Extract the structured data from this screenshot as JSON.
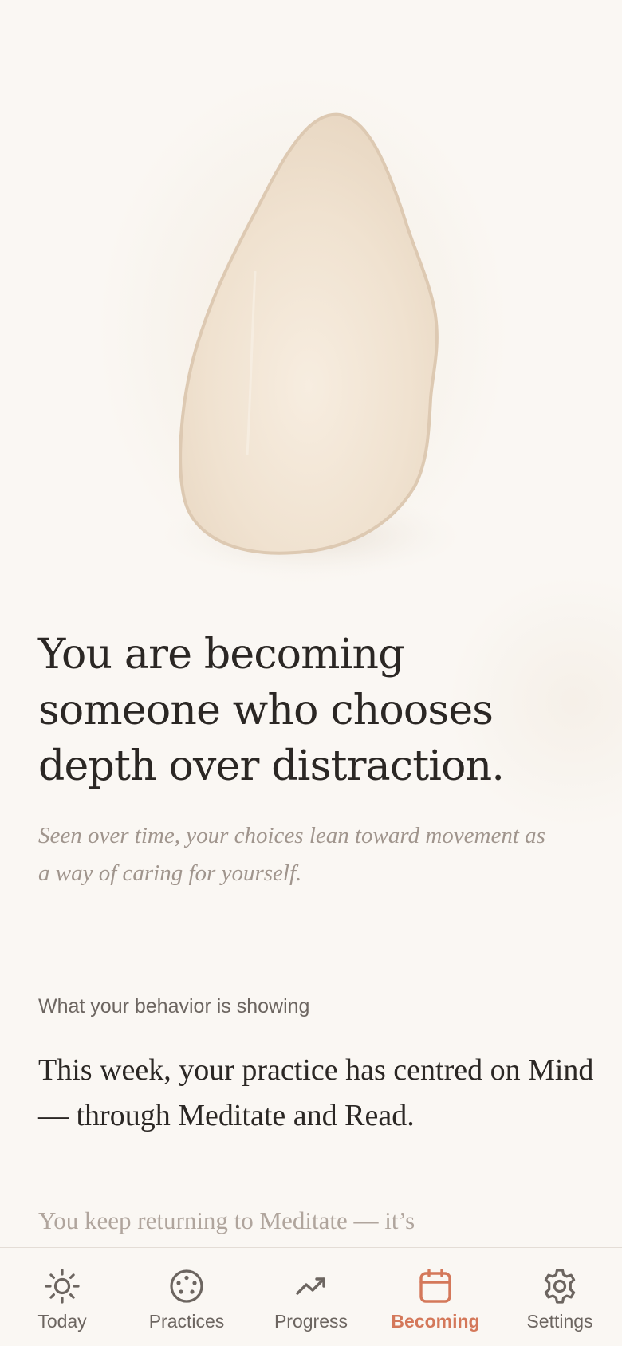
{
  "hero": {
    "headline": "You are becoming someone who chooses depth over distraction.",
    "subline": "Seen over time, your choices lean toward movement as a way of caring for yourself."
  },
  "insight": {
    "section_label": "What your behavior is showing",
    "week_text": "This week, your practice has centred on Mind — through Meditate and Read.",
    "partial_text": "You keep returning to Meditate — it’s"
  },
  "tabbar": {
    "active_tab": "Becoming",
    "accent_color": "#d4785a",
    "tabs": [
      {
        "label": "Today",
        "icon": "sun-icon"
      },
      {
        "label": "Practices",
        "icon": "palette-icon"
      },
      {
        "label": "Progress",
        "icon": "trending-up-icon"
      },
      {
        "label": "Becoming",
        "icon": "calendar-icon"
      },
      {
        "label": "Settings",
        "icon": "gear-icon"
      }
    ]
  }
}
